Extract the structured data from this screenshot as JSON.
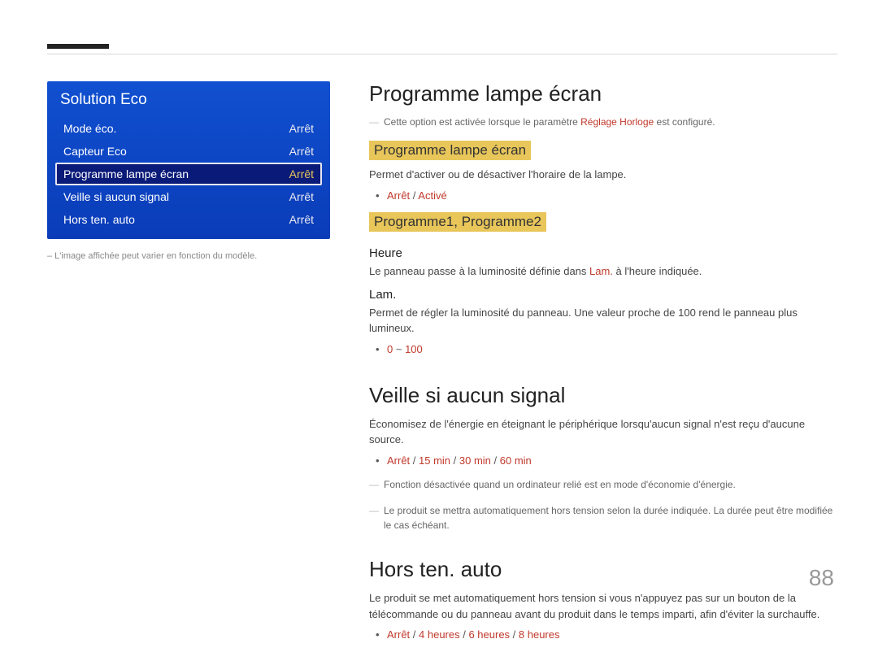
{
  "menu": {
    "title": "Solution Eco",
    "rows": [
      {
        "label": "Mode éco.",
        "value": "Arrêt",
        "active": false
      },
      {
        "label": "Capteur Eco",
        "value": "Arrêt",
        "active": false
      },
      {
        "label": "Programme lampe écran",
        "value": "Arrêt",
        "active": true
      },
      {
        "label": "Veille si aucun signal",
        "value": "Arrêt",
        "active": false
      },
      {
        "label": "Hors ten. auto",
        "value": "Arrêt",
        "active": false
      }
    ],
    "note": "–  L'image affichée peut varier en fonction du modèle."
  },
  "content": {
    "s1": {
      "title": "Programme lampe écran",
      "note_pre": "Cette option est activée lorsque le paramètre ",
      "note_emph": "Réglage Horloge",
      "note_post": " est configuré.",
      "sub1_hl": "Programme lampe écran",
      "sub1_desc": "Permet d'activer ou de désactiver l'horaire de la lampe.",
      "sub1_opt_a": "Arrêt",
      "sub1_opt_b": "Activé",
      "sub2_hl": "Programme1, Programme2",
      "heure_h": "Heure",
      "heure_pre": "Le panneau passe à la luminosité définie dans ",
      "heure_emph": "Lam.",
      "heure_post": " à l'heure indiquée.",
      "lam_h": "Lam.",
      "lam_desc": "Permet de régler la luminosité du panneau. Une valeur proche de 100 rend le panneau plus lumineux.",
      "lam_opt": "0",
      "lam_opt2": "100",
      "lam_tilde": " ~ "
    },
    "s2": {
      "title": "Veille si aucun signal",
      "desc": "Économisez de l'énergie en éteignant le périphérique lorsqu'aucun signal n'est reçu d'aucune source.",
      "opt_a": "Arrêt",
      "opt_b": "15 min",
      "opt_c": "30 min",
      "opt_d": "60 min",
      "note1": "Fonction désactivée quand un ordinateur relié est en mode d'économie d'énergie.",
      "note2": "Le produit se mettra automatiquement hors tension selon la durée indiquée. La durée peut être modifiée le cas échéant."
    },
    "s3": {
      "title": "Hors ten. auto",
      "desc": "Le produit se met automatiquement hors tension si vous n'appuyez pas sur un bouton de la télécommande ou du panneau avant du produit dans le temps imparti, afin d'éviter la surchauffe.",
      "opt_a": "Arrêt",
      "opt_b": "4 heures",
      "opt_c": "6 heures",
      "opt_d": "8 heures"
    }
  },
  "page": "88"
}
